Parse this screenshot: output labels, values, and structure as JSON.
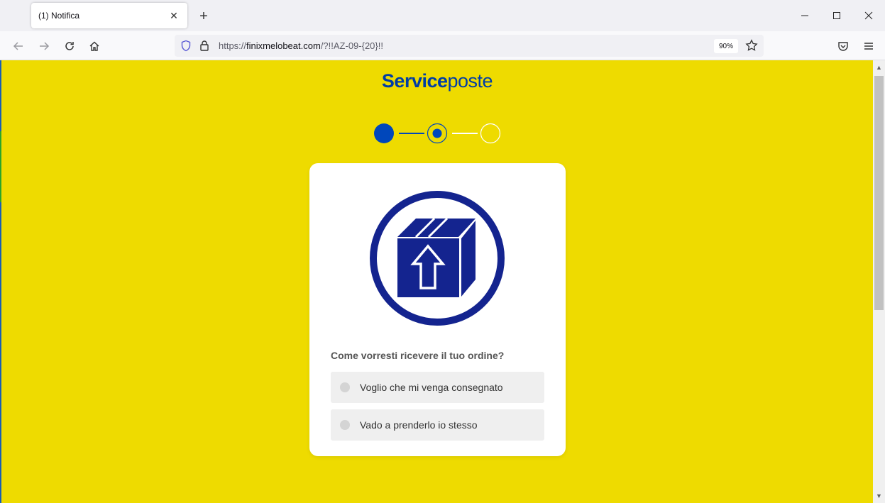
{
  "browser": {
    "tab_title": "(1) Notifica",
    "tab_close": "✕",
    "new_tab": "+",
    "url_prefix": "https://",
    "url_domain": "finixmelobeat.com",
    "url_path": "/?!!AZ-09-{20}!!",
    "zoom": "90%"
  },
  "logo": {
    "bold": "Service",
    "regular": "poste",
    "color": "#003da5"
  },
  "stepper": {
    "total": 3,
    "current": 2,
    "active_color": "#0047bb"
  },
  "card": {
    "question": "Come vorresti ricevere il tuo ordine?",
    "options": [
      {
        "label": "Voglio che mi venga consegnato"
      },
      {
        "label": "Vado a prenderlo io stesso"
      }
    ]
  },
  "colors": {
    "page_background": "#eedb00",
    "brand_blue": "#14248f"
  }
}
